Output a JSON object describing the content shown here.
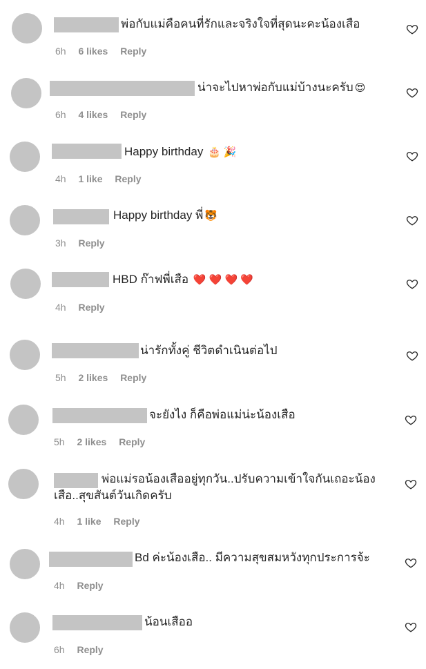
{
  "comments": [
    {
      "text": "พ่อกับแม่คือคนที่รักและจริงใจที่สุดนะคะน้องเสือ",
      "emoji": "",
      "time": "6h",
      "likes": "6 likes",
      "reply": "Reply"
    },
    {
      "text": "น่าจะไปหาพ่อกับแม่บ้างนะครับ",
      "emoji": "😍",
      "time": "6h",
      "likes": "4 likes",
      "reply": "Reply"
    },
    {
      "text": "Happy birthday",
      "emoji": "🎂 🎉",
      "time": "4h",
      "likes": "1 like",
      "reply": "Reply"
    },
    {
      "text": "Happy birthday พี่",
      "emoji": "🐯",
      "time": "3h",
      "likes": "",
      "reply": "Reply"
    },
    {
      "text": "HBD ก๊าฟพี่เสือ",
      "emoji": "❤️ ❤️ ❤️ ❤️",
      "time": "4h",
      "likes": "",
      "reply": "Reply"
    },
    {
      "text": "น่ารักทั้งคู่ ชีวิตดำเนินต่อไป",
      "emoji": "",
      "time": "5h",
      "likes": "2 likes",
      "reply": "Reply"
    },
    {
      "text": "จะยังไง ก็คือพ่อแม่น่ะน้องเสือ",
      "emoji": "",
      "time": "5h",
      "likes": "2 likes",
      "reply": "Reply"
    },
    {
      "text": "พ่อแม่รอน้องเสืออยู่ทุกวัน..ปรับความเข้าใจกันเถอะน้อง",
      "text2": "เสือ..สุขสันต์วันเกิดครับ",
      "emoji": "",
      "time": "4h",
      "likes": "1 like",
      "reply": "Reply"
    },
    {
      "text": "Bd ค่ะน้องเสือ.. มีความสุขสมหวังทุกประการจ้ะ",
      "emoji": "",
      "time": "4h",
      "likes": "",
      "reply": "Reply"
    },
    {
      "text": "น้อนเสืออ",
      "emoji": "",
      "time": "6h",
      "likes": "",
      "reply": "Reply"
    }
  ],
  "icons": {
    "avatar": "avatar-placeholder",
    "like": "heart-icon"
  },
  "colors": {
    "avatar": "#c4c4c4",
    "meta": "#8e8e8e",
    "text": "#262626",
    "heart_emoji": "#e0245e"
  }
}
